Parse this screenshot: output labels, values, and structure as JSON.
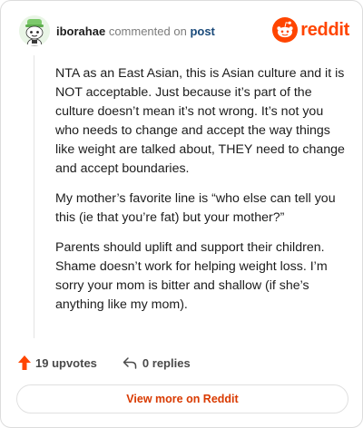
{
  "comment": {
    "username": "iborahae",
    "action_text": "commented on",
    "post_link": "post",
    "paragraphs": [
      "NTA as an East Asian, this is Asian culture and it is NOT acceptable. Just because it’s part of the culture doesn’t mean it’s not wrong. It’s not you who needs to change and accept the way things like weight are talked about, THEY need to change and accept boundaries.",
      "My mother’s favorite line is “who else can tell you this (ie that you’re fat) but your mother?”",
      "Parents should uplift and support their children. Shame doesn’t work for helping weight loss. I’m sorry your mom is bitter and shallow (if she’s anything like my mom)."
    ],
    "upvotes": "19 upvotes",
    "replies": "0 replies"
  },
  "brand": {
    "logo_text": "reddit",
    "accent": "#ff4500"
  },
  "footer": {
    "view_more": "View more on Reddit"
  },
  "icons": {
    "avatar": "snoo-avatar-icon",
    "logo": "reddit-logo-icon",
    "upvote": "upvote-arrow-icon",
    "reply": "reply-arrow-icon"
  }
}
